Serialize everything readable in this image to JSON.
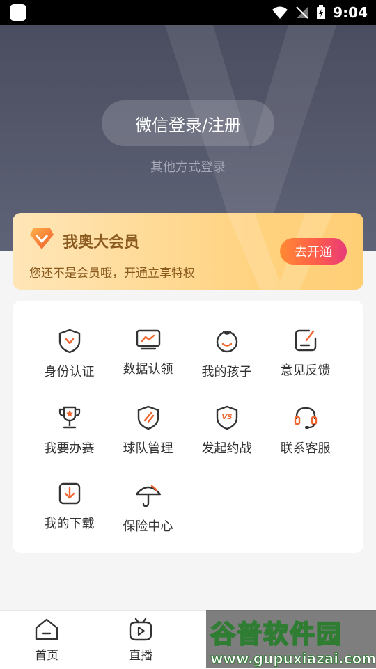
{
  "status_bar": {
    "time": "9:04"
  },
  "hero": {
    "login_button": "微信登录/注册",
    "other_login": "其他方式登录"
  },
  "vip": {
    "title": "我奥大会员",
    "desc": "您还不是会员哦，开通立享特权",
    "button": "去开通"
  },
  "services": [
    {
      "label": "身份认证",
      "icon": "shield-v-icon"
    },
    {
      "label": "数据认领",
      "icon": "chart-monitor-icon"
    },
    {
      "label": "我的孩子",
      "icon": "child-face-icon"
    },
    {
      "label": "意见反馈",
      "icon": "edit-feedback-icon"
    },
    {
      "label": "我要办赛",
      "icon": "trophy-icon"
    },
    {
      "label": "球队管理",
      "icon": "shield-slash-icon"
    },
    {
      "label": "发起约战",
      "icon": "vs-shield-icon"
    },
    {
      "label": "联系客服",
      "icon": "headset-icon"
    },
    {
      "label": "我的下载",
      "icon": "download-icon"
    },
    {
      "label": "保险中心",
      "icon": "umbrella-icon"
    }
  ],
  "bottom_nav": {
    "items": [
      {
        "label": "首页",
        "icon": "home-icon"
      },
      {
        "label": "直播",
        "icon": "tv-icon"
      }
    ]
  },
  "watermark": {
    "line1": "谷普软件园",
    "line2": "www.gupuxiazai.com"
  },
  "colors": {
    "accent_orange": "#f0642d",
    "icon_dark": "#333333",
    "vip_text": "#8a5a1f"
  }
}
